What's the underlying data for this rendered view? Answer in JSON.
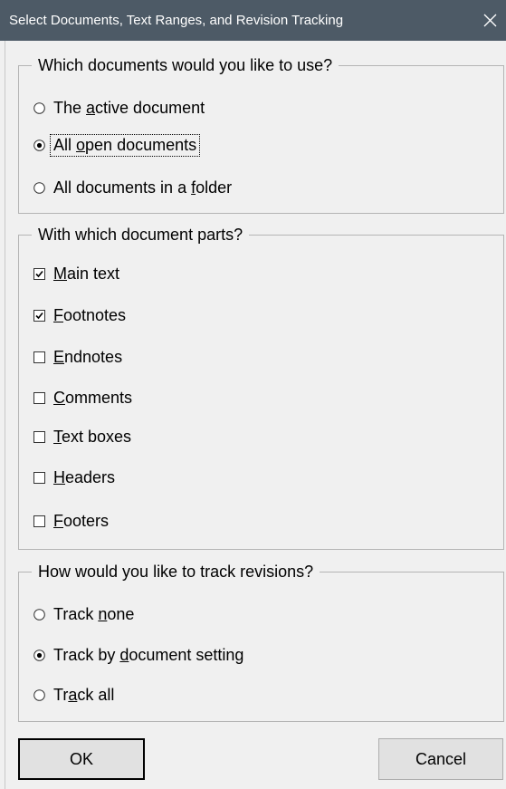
{
  "window": {
    "title": "Select Documents, Text Ranges, and Revision Tracking"
  },
  "documents_group": {
    "legend": "Which documents would you like to use?",
    "options": [
      {
        "pre": "The ",
        "u": "a",
        "post": "ctive document",
        "selected": false
      },
      {
        "pre": "All ",
        "u": "o",
        "post": "pen documents",
        "selected": true
      },
      {
        "pre": "All documents in a ",
        "u": "f",
        "post": "older",
        "selected": false
      }
    ]
  },
  "parts_group": {
    "legend": "With which document parts?",
    "options": [
      {
        "pre": "",
        "u": "M",
        "post": "ain text",
        "checked": true
      },
      {
        "pre": "",
        "u": "F",
        "post": "ootnotes",
        "checked": true
      },
      {
        "pre": "",
        "u": "E",
        "post": "ndnotes",
        "checked": false
      },
      {
        "pre": "",
        "u": "C",
        "post": "omments",
        "checked": false
      },
      {
        "pre": "",
        "u": "T",
        "post": "ext boxes",
        "checked": false
      },
      {
        "pre": "",
        "u": "H",
        "post": "eaders",
        "checked": false
      },
      {
        "pre": "",
        "u": "F",
        "post": "ooters",
        "checked": false
      }
    ]
  },
  "revisions_group": {
    "legend": "How would you like to track revisions?",
    "options": [
      {
        "pre": "Track ",
        "u": "n",
        "post": "one",
        "selected": false
      },
      {
        "pre": "Track by ",
        "u": "d",
        "post": "ocument setting",
        "selected": true
      },
      {
        "pre": "Tr",
        "u": "a",
        "post": "ck all",
        "selected": false
      }
    ]
  },
  "buttons": {
    "ok": "OK",
    "cancel": "Cancel"
  },
  "colors": {
    "titlebar": "#4d5a66",
    "dialog_bg": "#f0f0f0",
    "group_border": "#b4b4b4",
    "button_bg": "#e1e1e1"
  }
}
